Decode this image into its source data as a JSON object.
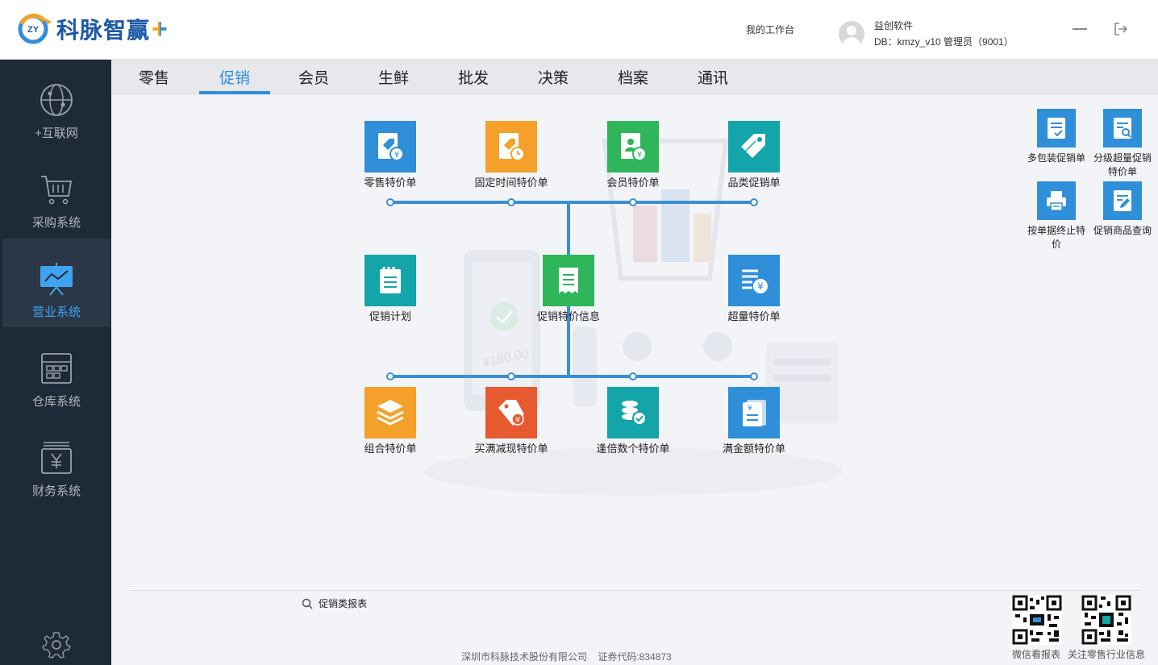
{
  "header": {
    "logo_badge": "ZY",
    "logo_text": "科脉智赢",
    "logo_plus": "+",
    "workbench": "我的工作台",
    "user_name": "益创软件",
    "user_db": "DB：kmzy_v10   管理员（9001）"
  },
  "sidebar": {
    "items": [
      {
        "label": "+互联网",
        "icon": "globe-icon"
      },
      {
        "label": "采购系统",
        "icon": "cart-icon"
      },
      {
        "label": "营业系统",
        "icon": "presentation-chart-icon",
        "active": true
      },
      {
        "label": "仓库系统",
        "icon": "warehouse-icon"
      },
      {
        "label": "财务系统",
        "icon": "finance-icon"
      }
    ],
    "settings_icon": "gear-icon"
  },
  "tabs": [
    {
      "label": "零售"
    },
    {
      "label": "促销",
      "active": true
    },
    {
      "label": "会员"
    },
    {
      "label": "生鲜"
    },
    {
      "label": "批发"
    },
    {
      "label": "决策"
    },
    {
      "label": "档案"
    },
    {
      "label": "通讯"
    }
  ],
  "flow": {
    "top": [
      {
        "label": "零售特价单",
        "color": "#2f8fd8"
      },
      {
        "label": "固定时间特价单",
        "color": "#f4a02a"
      },
      {
        "label": "会员特价单",
        "color": "#2fb55a"
      },
      {
        "label": "品类促销单",
        "color": "#13a5a9"
      }
    ],
    "middle": [
      {
        "label": "促销计划",
        "color": "#13a5a9"
      },
      {
        "label": "促销特价信息",
        "color": "#2fb55a"
      },
      {
        "label": "超量特价单",
        "color": "#2f8fd8"
      }
    ],
    "bottom": [
      {
        "label": "组合特价单",
        "color": "#f4a02a"
      },
      {
        "label": "买满减现特价单",
        "color": "#e75a2f"
      },
      {
        "label": "逢倍数个特价单",
        "color": "#13a5a9"
      },
      {
        "label": "满金额特价单",
        "color": "#2f8fd8"
      }
    ]
  },
  "illustration": {
    "price_text": "¥180.00"
  },
  "quick": [
    {
      "label": "多包装促销单"
    },
    {
      "label": "分级超量促销特价单"
    },
    {
      "label": "按单据终止特价"
    },
    {
      "label": "促销商品查询"
    }
  ],
  "bottom": {
    "report_link": "促销类报表",
    "company": "深圳市科脉技术股份有限公司    证券代码:834873",
    "qr1_label": "微信看报表",
    "qr2_label": "关注零售行业信息"
  }
}
